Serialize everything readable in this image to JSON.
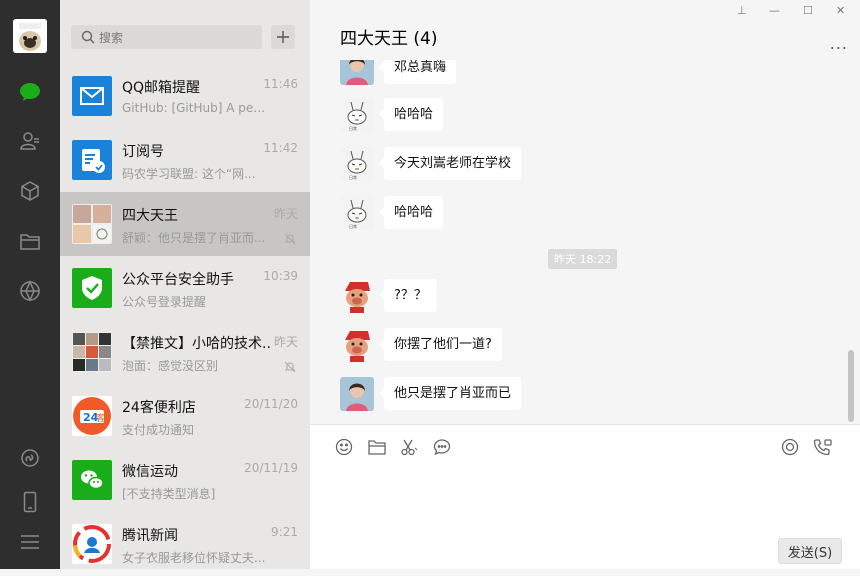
{
  "search": {
    "placeholder": "搜索"
  },
  "chats": [
    {
      "name": "QQ邮箱提醒",
      "preview": "GitHub: [GitHub] A per...",
      "time": "11:46",
      "icon": "mail-icon"
    },
    {
      "name": "订阅号",
      "preview": "码农学习联盟: 这个“网...",
      "time": "11:42",
      "icon": "subscription-icon"
    },
    {
      "name": "四大天王",
      "preview": "舒颖：他只是摆了肖亚而...",
      "time": "昨天",
      "icon": "group-avatar",
      "muted": true
    },
    {
      "name": "公众平台安全助手",
      "preview": "公众号登录提醒",
      "time": "10:39",
      "icon": "shield-icon"
    },
    {
      "name": "【禁推文】小哈的技术...",
      "preview": "泡面：感觉没区别",
      "time": "昨天",
      "icon": "group-avatar",
      "muted": true
    },
    {
      "name": "24客便利店",
      "preview": "支付成功通知",
      "time": "20/11/20",
      "icon": "store-logo"
    },
    {
      "name": "微信运动",
      "preview": "[不支持类型消息]",
      "time": "20/11/19",
      "icon": "wechat-sport-icon"
    },
    {
      "name": "腾讯新闻",
      "preview": "女子衣服老移位怀疑丈夫...",
      "time": "9:21",
      "icon": "tencent-news-logo"
    }
  ],
  "conversation": {
    "title": "四大天王 (4)",
    "messages": [
      {
        "sender": "girl",
        "text": "邓总真嗨"
      },
      {
        "sender": "bunny",
        "text": "哈哈哈"
      },
      {
        "sender": "bunny",
        "text": "今天刘嵩老师在学校"
      },
      {
        "sender": "bunny",
        "text": "哈哈哈"
      },
      {
        "sender": "pig",
        "text": "?？？"
      },
      {
        "sender": "pig",
        "text": "你摆了他们一道?"
      },
      {
        "sender": "girl",
        "text": "他只是摆了肖亚而已"
      }
    ],
    "timestamp": "昨天 18:22"
  },
  "composer": {
    "send_label": "发送(S)"
  },
  "window": {
    "pin": "⊥",
    "minimize": "—",
    "maximize": "☐",
    "close": "✕",
    "more": "..."
  },
  "colors": {
    "accent": "#1aad19",
    "rail": "#2e2e2e",
    "list": "#e8e7e6",
    "selected": "#c8c6c5"
  }
}
